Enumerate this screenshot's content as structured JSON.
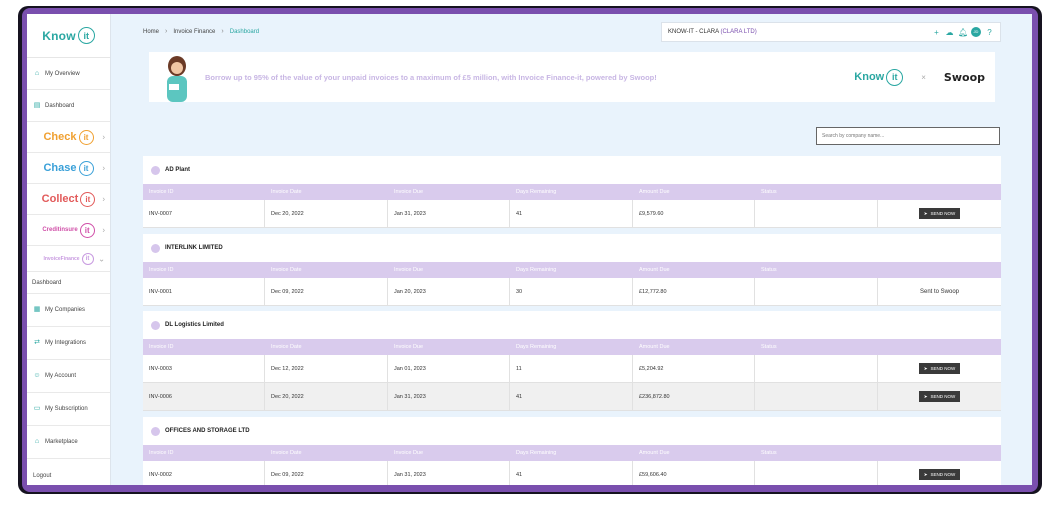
{
  "sidebar": {
    "logo_text": "Know",
    "logo_mark": "it",
    "items_top": [
      {
        "label": "My Overview",
        "icon": "home-icon"
      },
      {
        "label": "Dashboard",
        "icon": "dashboard-icon"
      }
    ],
    "brands": [
      {
        "name": "Check",
        "mark": "it",
        "color": "#f0a030"
      },
      {
        "name": "Chase",
        "mark": "it",
        "color": "#3aa0d8"
      },
      {
        "name": "Collect",
        "mark": "it",
        "color": "#e25a5a"
      },
      {
        "name": "Creditinsure",
        "mark": "it",
        "color": "#d04fa8"
      },
      {
        "name": "InvoiceFinance",
        "mark": "it",
        "color": "#c89ae0"
      }
    ],
    "items_bottom": [
      {
        "label": "Dashboard",
        "icon": "dashboard-icon"
      },
      {
        "label": "My Companies",
        "icon": "companies-icon"
      },
      {
        "label": "My Integrations",
        "icon": "integrations-icon"
      },
      {
        "label": "My Account",
        "icon": "account-icon"
      },
      {
        "label": "My Subscription",
        "icon": "subscription-icon"
      },
      {
        "label": "Marketplace",
        "icon": "marketplace-icon"
      },
      {
        "label": "Logout",
        "icon": ""
      }
    ]
  },
  "breadcrumb": [
    "Home",
    "Invoice Finance",
    "Dashboard"
  ],
  "topbar": {
    "company": "KNOW-IT - CLARA",
    "company_sub": "(CLARA LTD)",
    "avatar": "JD"
  },
  "banner": {
    "text": "Borrow up to 95% of the value of your unpaid invoices to a maximum of £5 million, with Invoice Finance-it, powered by Swoop!",
    "brand1": "Know",
    "brand1_mark": "it",
    "separator": "×",
    "brand2": "Swoop"
  },
  "search": {
    "placeholder": "Search by company name..."
  },
  "columns": [
    "Invoice ID",
    "Invoice Date",
    "Invoice Due",
    "Days Remaining",
    "Amount Due",
    "Status",
    ""
  ],
  "groups": [
    {
      "company": "AD Plant",
      "rows": [
        {
          "id": "INV-0007",
          "date": "Dec 20, 2022",
          "due": "Jan 31, 2023",
          "days": "41",
          "amount": "£9,579.60",
          "status": "",
          "action": "SEND NOW"
        }
      ]
    },
    {
      "company": "INTERLINK LIMITED",
      "rows": [
        {
          "id": "INV-0001",
          "date": "Dec 09, 2022",
          "due": "Jan 20, 2023",
          "days": "30",
          "amount": "£12,772.80",
          "status": "",
          "action": "Sent to Swoop"
        }
      ]
    },
    {
      "company": "DL Logistics Limited",
      "rows": [
        {
          "id": "INV-0003",
          "date": "Dec 12, 2022",
          "due": "Jan 01, 2023",
          "days": "11",
          "amount": "£5,204.92",
          "status": "",
          "action": "SEND NOW"
        },
        {
          "id": "INV-0006",
          "date": "Dec 20, 2022",
          "due": "Jan 31, 2023",
          "days": "41",
          "amount": "£236,872.80",
          "status": "",
          "action": "SEND NOW"
        }
      ]
    },
    {
      "company": "OFFICES AND STORAGE LTD",
      "rows": [
        {
          "id": "INV-0002",
          "date": "Dec 09, 2022",
          "due": "Jan 31, 2023",
          "days": "41",
          "amount": "£59,606.40",
          "status": "",
          "action": "SEND NOW"
        }
      ]
    }
  ]
}
